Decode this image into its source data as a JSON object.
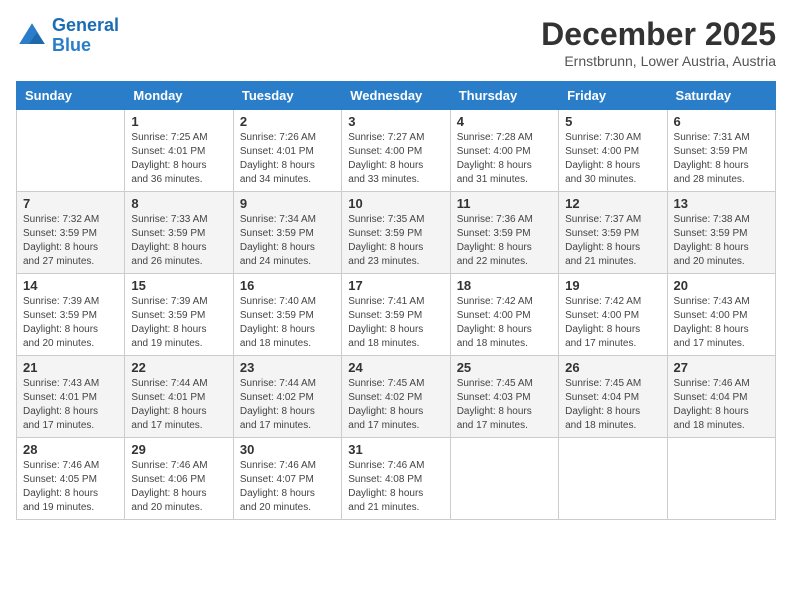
{
  "header": {
    "logo_line1": "General",
    "logo_line2": "Blue",
    "month_title": "December 2025",
    "location": "Ernstbrunn, Lower Austria, Austria"
  },
  "weekdays": [
    "Sunday",
    "Monday",
    "Tuesday",
    "Wednesday",
    "Thursday",
    "Friday",
    "Saturday"
  ],
  "weeks": [
    [
      {
        "day": "",
        "info": ""
      },
      {
        "day": "1",
        "info": "Sunrise: 7:25 AM\nSunset: 4:01 PM\nDaylight: 8 hours\nand 36 minutes."
      },
      {
        "day": "2",
        "info": "Sunrise: 7:26 AM\nSunset: 4:01 PM\nDaylight: 8 hours\nand 34 minutes."
      },
      {
        "day": "3",
        "info": "Sunrise: 7:27 AM\nSunset: 4:00 PM\nDaylight: 8 hours\nand 33 minutes."
      },
      {
        "day": "4",
        "info": "Sunrise: 7:28 AM\nSunset: 4:00 PM\nDaylight: 8 hours\nand 31 minutes."
      },
      {
        "day": "5",
        "info": "Sunrise: 7:30 AM\nSunset: 4:00 PM\nDaylight: 8 hours\nand 30 minutes."
      },
      {
        "day": "6",
        "info": "Sunrise: 7:31 AM\nSunset: 3:59 PM\nDaylight: 8 hours\nand 28 minutes."
      }
    ],
    [
      {
        "day": "7",
        "info": "Sunrise: 7:32 AM\nSunset: 3:59 PM\nDaylight: 8 hours\nand 27 minutes."
      },
      {
        "day": "8",
        "info": "Sunrise: 7:33 AM\nSunset: 3:59 PM\nDaylight: 8 hours\nand 26 minutes."
      },
      {
        "day": "9",
        "info": "Sunrise: 7:34 AM\nSunset: 3:59 PM\nDaylight: 8 hours\nand 24 minutes."
      },
      {
        "day": "10",
        "info": "Sunrise: 7:35 AM\nSunset: 3:59 PM\nDaylight: 8 hours\nand 23 minutes."
      },
      {
        "day": "11",
        "info": "Sunrise: 7:36 AM\nSunset: 3:59 PM\nDaylight: 8 hours\nand 22 minutes."
      },
      {
        "day": "12",
        "info": "Sunrise: 7:37 AM\nSunset: 3:59 PM\nDaylight: 8 hours\nand 21 minutes."
      },
      {
        "day": "13",
        "info": "Sunrise: 7:38 AM\nSunset: 3:59 PM\nDaylight: 8 hours\nand 20 minutes."
      }
    ],
    [
      {
        "day": "14",
        "info": "Sunrise: 7:39 AM\nSunset: 3:59 PM\nDaylight: 8 hours\nand 20 minutes."
      },
      {
        "day": "15",
        "info": "Sunrise: 7:39 AM\nSunset: 3:59 PM\nDaylight: 8 hours\nand 19 minutes."
      },
      {
        "day": "16",
        "info": "Sunrise: 7:40 AM\nSunset: 3:59 PM\nDaylight: 8 hours\nand 18 minutes."
      },
      {
        "day": "17",
        "info": "Sunrise: 7:41 AM\nSunset: 3:59 PM\nDaylight: 8 hours\nand 18 minutes."
      },
      {
        "day": "18",
        "info": "Sunrise: 7:42 AM\nSunset: 4:00 PM\nDaylight: 8 hours\nand 18 minutes."
      },
      {
        "day": "19",
        "info": "Sunrise: 7:42 AM\nSunset: 4:00 PM\nDaylight: 8 hours\nand 17 minutes."
      },
      {
        "day": "20",
        "info": "Sunrise: 7:43 AM\nSunset: 4:00 PM\nDaylight: 8 hours\nand 17 minutes."
      }
    ],
    [
      {
        "day": "21",
        "info": "Sunrise: 7:43 AM\nSunset: 4:01 PM\nDaylight: 8 hours\nand 17 minutes."
      },
      {
        "day": "22",
        "info": "Sunrise: 7:44 AM\nSunset: 4:01 PM\nDaylight: 8 hours\nand 17 minutes."
      },
      {
        "day": "23",
        "info": "Sunrise: 7:44 AM\nSunset: 4:02 PM\nDaylight: 8 hours\nand 17 minutes."
      },
      {
        "day": "24",
        "info": "Sunrise: 7:45 AM\nSunset: 4:02 PM\nDaylight: 8 hours\nand 17 minutes."
      },
      {
        "day": "25",
        "info": "Sunrise: 7:45 AM\nSunset: 4:03 PM\nDaylight: 8 hours\nand 17 minutes."
      },
      {
        "day": "26",
        "info": "Sunrise: 7:45 AM\nSunset: 4:04 PM\nDaylight: 8 hours\nand 18 minutes."
      },
      {
        "day": "27",
        "info": "Sunrise: 7:46 AM\nSunset: 4:04 PM\nDaylight: 8 hours\nand 18 minutes."
      }
    ],
    [
      {
        "day": "28",
        "info": "Sunrise: 7:46 AM\nSunset: 4:05 PM\nDaylight: 8 hours\nand 19 minutes."
      },
      {
        "day": "29",
        "info": "Sunrise: 7:46 AM\nSunset: 4:06 PM\nDaylight: 8 hours\nand 20 minutes."
      },
      {
        "day": "30",
        "info": "Sunrise: 7:46 AM\nSunset: 4:07 PM\nDaylight: 8 hours\nand 20 minutes."
      },
      {
        "day": "31",
        "info": "Sunrise: 7:46 AM\nSunset: 4:08 PM\nDaylight: 8 hours\nand 21 minutes."
      },
      {
        "day": "",
        "info": ""
      },
      {
        "day": "",
        "info": ""
      },
      {
        "day": "",
        "info": ""
      }
    ]
  ]
}
